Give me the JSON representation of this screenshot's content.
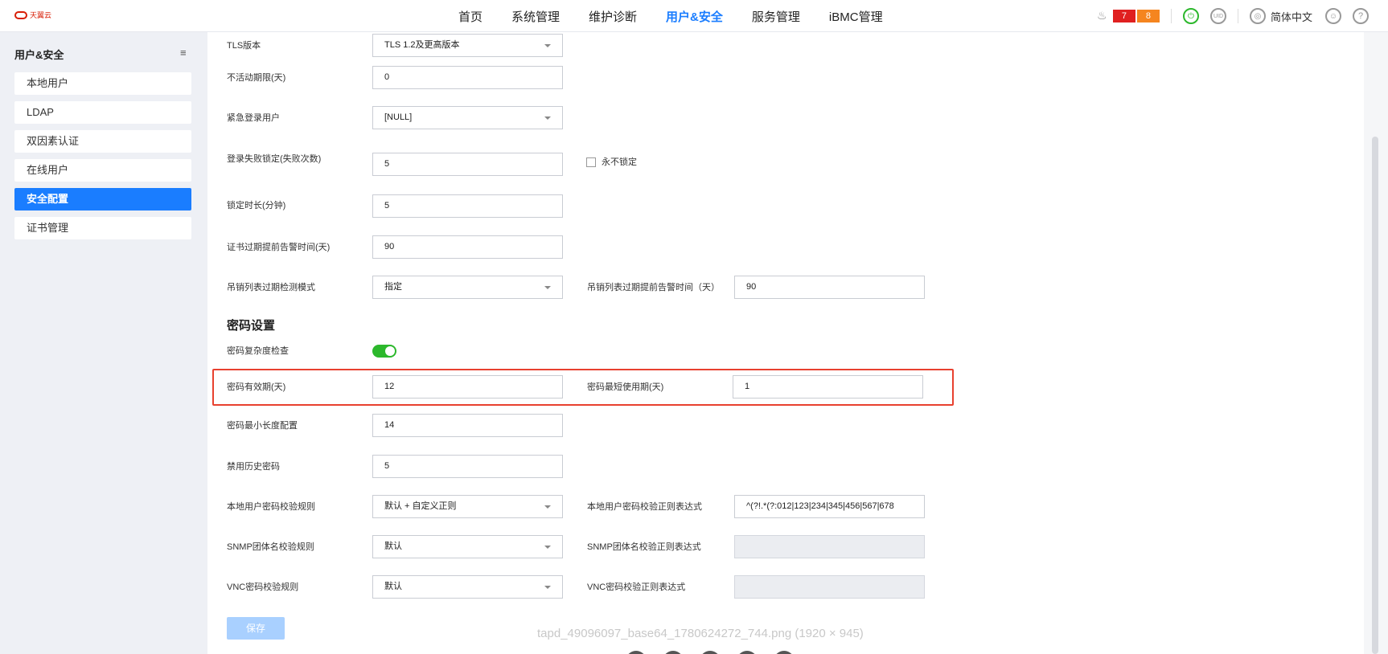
{
  "app": {
    "logo_text": "天翼云"
  },
  "nav": {
    "items": [
      "首页",
      "系统管理",
      "维护诊断",
      "用户&安全",
      "服务管理",
      "iBMC管理"
    ],
    "active_index": 3
  },
  "header": {
    "alerts_critical": "7",
    "alerts_major": "8",
    "uid_label": "UID",
    "language": "简体中文",
    "help_label": "?"
  },
  "sidebar": {
    "title": "用户&安全",
    "items": [
      "本地用户",
      "LDAP",
      "双因素认证",
      "在线用户",
      "安全配置",
      "证书管理"
    ],
    "active_index": 4
  },
  "form": {
    "tls_label": "TLS版本",
    "tls_value": "TLS 1.2及更高版本",
    "inactive_label": "不活动期限(天)",
    "inactive_value": "0",
    "emergency_label": "紧急登录用户",
    "emergency_value": "[NULL]",
    "lockout_label": "登录失败锁定(失败次数)",
    "lockout_value": "5",
    "never_lock_label": "永不锁定",
    "lock_duration_label": "锁定时长(分钟)",
    "lock_duration_value": "5",
    "cert_warn_label": "证书过期提前告警时间(天)",
    "cert_warn_value": "90",
    "crl_mode_label": "吊销列表过期检测模式",
    "crl_mode_value": "指定",
    "crl_warn_label": "吊销列表过期提前告警时间（天）",
    "crl_warn_value": "90"
  },
  "password": {
    "section_title": "密码设置",
    "complexity_label": "密码复杂度检查",
    "complexity_enabled": true,
    "validity_label": "密码有效期(天)",
    "validity_value": "12",
    "min_use_label": "密码最短使用期(天)",
    "min_use_value": "1",
    "min_length_label": "密码最小长度配置",
    "min_length_value": "14",
    "history_label": "禁用历史密码",
    "history_value": "5",
    "local_rule_label": "本地用户密码校验规则",
    "local_rule_value": "默认 + 自定义正则",
    "local_regex_label": "本地用户密码校验正则表达式",
    "local_regex_value": "^(?!.*(?:012|123|234|345|456|567|678",
    "snmp_rule_label": "SNMP团体名校验规则",
    "snmp_rule_value": "默认",
    "snmp_regex_label": "SNMP团体名校验正则表达式",
    "snmp_regex_value": "",
    "vnc_rule_label": "VNC密码校验规则",
    "vnc_rule_value": "默认",
    "vnc_regex_label": "VNC密码校验正则表达式",
    "vnc_regex_value": "",
    "save_label": "保存"
  },
  "overlay": {
    "caption": "tapd_49096097_base64_1780624272_744.png (1920 × 945)"
  }
}
